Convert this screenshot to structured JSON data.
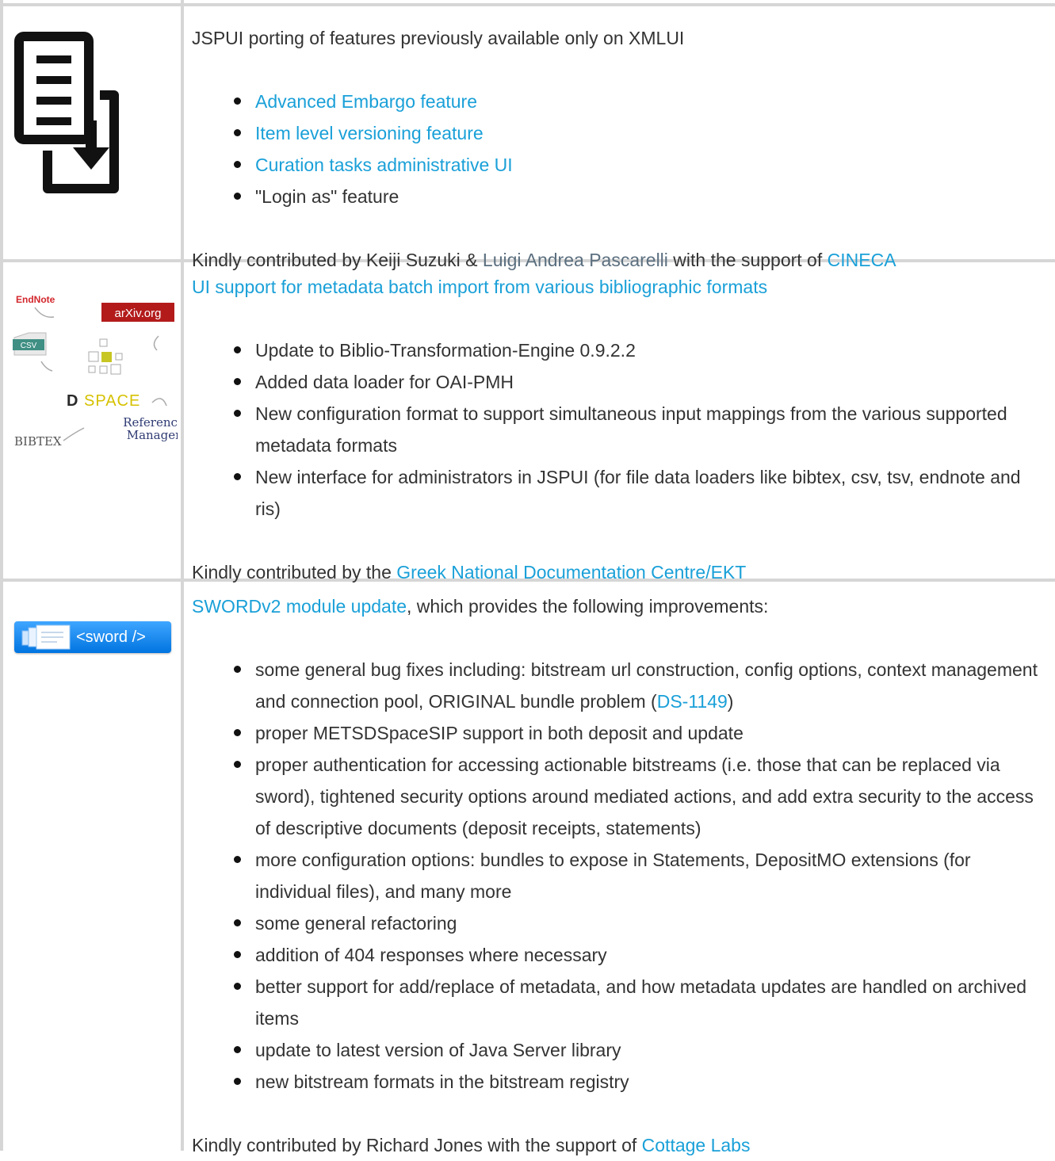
{
  "row1": {
    "intro": "JSPUI porting of features previously available only on XMLUI",
    "items": [
      {
        "text": "Advanced Embargo feature",
        "link": true
      },
      {
        "text": "Item level versioning feature",
        "link": true
      },
      {
        "text": "Curation tasks administrative UI",
        "link": true
      },
      {
        "text": "\"Login as\" feature",
        "link": false
      }
    ],
    "credit": {
      "prefix": "Kindly contributed by Keiji Suzuki & ",
      "person": "Luigi Andrea Pascarelli",
      "middle": " with the support of ",
      "org": "CINECA"
    },
    "icon": "document-download-icon"
  },
  "row2": {
    "intro_link": "UI support for metadata batch import from various bibliographic formats",
    "items": [
      "Update to Biblio-Transformation-Engine 0.9.2.2",
      "Added data loader for OAI-PMH",
      "New configuration format to support simultaneous input mappings from the various supported metadata formats",
      "New interface for administrators in JSPUI (for file data loaders like bibtex, csv, tsv, endnote and ris)"
    ],
    "credit": {
      "prefix": "Kindly contributed by the ",
      "org": "Greek National Documentation Centre/EKT"
    },
    "logo": {
      "endnote": "EndNote",
      "arxiv": "arXiv.org",
      "csv": "CSV",
      "dspace_d": "D",
      "dspace_rest": "SPACE",
      "bibtex": "BIBTEX",
      "refman1": "Reference",
      "refman2": "Manager"
    }
  },
  "row3": {
    "intro_link": "SWORDv2 module update",
    "intro_rest": ", which provides the following improvements:",
    "items": [
      {
        "text": "some general bug fixes including: bitstream url construction, config options, context management and connection pool, ORIGINAL bundle problem (",
        "link": "DS-1149",
        "after": ")"
      },
      {
        "text": "proper METSDSpaceSIP support in both deposit and update"
      },
      {
        "text": "proper authentication for accessing actionable bitstreams (i.e. those that can be replaced via sword), tightened security options around mediated actions, and add extra security to the access of descriptive documents (deposit receipts, statements)"
      },
      {
        "text": "more configuration options: bundles to expose in Statements, DepositMO extensions (for individual files), and many more"
      },
      {
        "text": "some general refactoring"
      },
      {
        "text": "addition of 404 responses where necessary"
      },
      {
        "text": "better support for add/replace of metadata, and how metadata updates are handled on archived items"
      },
      {
        "text": "update to latest version of Java Server library"
      },
      {
        "text": "new bitstream formats in the bitstream registry"
      }
    ],
    "credit": {
      "prefix": "Kindly contributed by Richard Jones with the support of ",
      "org": "Cottage Labs"
    },
    "badge": "<sword />"
  },
  "colors": {
    "link": "#1aa0d8",
    "text": "#333333",
    "border": "#d6d6d6"
  }
}
